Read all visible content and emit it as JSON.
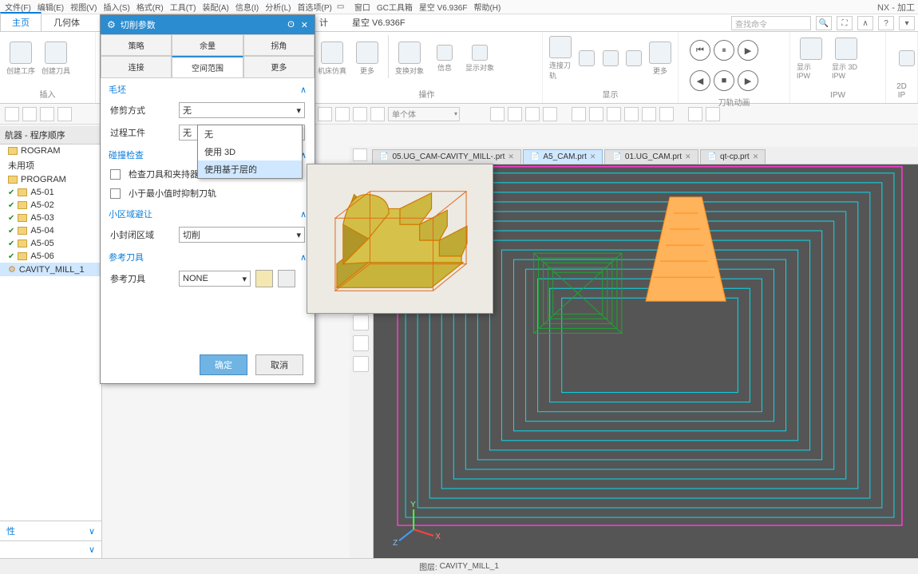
{
  "app_title": "NX - 加工",
  "menu": [
    "文件(F)",
    "编辑(E)",
    "视图(V)",
    "插入(S)",
    "格式(R)",
    "工具(T)",
    "装配(A)",
    "信息(I)",
    "分析(L)",
    "首选项(P)",
    "窗口",
    "GC工具箱",
    "星空 V6.936F",
    "帮助(H)"
  ],
  "ribbon_tabs": [
    "主页",
    "几何体",
    "计",
    "星空 V6.936F"
  ],
  "ribbon_tab_active": 0,
  "ribbon_groups": {
    "insert": "插入",
    "operate": "操作",
    "display": "显示",
    "toolpath": "刀轨动画",
    "ipw": "IPW",
    "2dipw": "2D IP"
  },
  "ribbon_btns": {
    "create_proc": "创建工序",
    "create_tool": "创建刀具",
    "machine": "机床仿真",
    "more1": "更多",
    "change_obj": "变换对象",
    "info": "信息",
    "show_obj": "显示对象",
    "connect_tool": "连接刀轨",
    "more2": "更多",
    "show_ipw": "显示 IPW",
    "show_3dipw": "显示 3D IPW"
  },
  "smallbar": {
    "select_label": "单个体"
  },
  "search_placeholder": "查找命令",
  "nav": {
    "header": "航器 - 程序顺序",
    "items": [
      {
        "text": "ROGRAM",
        "type": "folder"
      },
      {
        "text": "未用项",
        "type": "plain"
      },
      {
        "text": "PROGRAM",
        "type": "folder"
      },
      {
        "text": "A5-01",
        "type": "op",
        "chk": true
      },
      {
        "text": "A5-02",
        "type": "op",
        "chk": true
      },
      {
        "text": "A5-03",
        "type": "op",
        "chk": true
      },
      {
        "text": "A5-04",
        "type": "op",
        "chk": true
      },
      {
        "text": "A5-05",
        "type": "op",
        "chk": true
      },
      {
        "text": "A5-06",
        "type": "op",
        "chk": true
      },
      {
        "text": "CAVITY_MILL_1",
        "type": "tool",
        "sel": true
      }
    ],
    "bottom_section": "性"
  },
  "filetabs": [
    {
      "name": "05.UG_CAM-CAVITY_MILL-.prt",
      "active": false
    },
    {
      "name": "A5_CAM.prt",
      "active": true
    },
    {
      "name": "01.UG_CAM.prt",
      "active": false
    },
    {
      "name": "qt-cp.prt",
      "active": false
    }
  ],
  "status": {
    "label": "图层:",
    "value": "CAVITY_MILL_1"
  },
  "dialog": {
    "title": "切削参数",
    "tabs_top": [
      "策略",
      "余量",
      "拐角"
    ],
    "tabs_bot": [
      "连接",
      "空间范围",
      "更多"
    ],
    "active_tab": "空间范围",
    "sec_blank": "毛坯",
    "trim_mode": "修剪方式",
    "trim_mode_val": "无",
    "proc_wp": "过程工件",
    "proc_wp_val": "无",
    "proc_wp_opts": [
      "无",
      "使用 3D",
      "使用基于层的"
    ],
    "sec_collide": "碰撞检查",
    "chk1": "检查刀具和夹持器",
    "chk2": "小于最小值时抑制刀轨",
    "sec_small": "小区域避让",
    "small_area": "小封闭区域",
    "small_area_val": "切削",
    "sec_reftool": "参考刀具",
    "reftool_lbl": "参考刀具",
    "reftool_val": "NONE",
    "ok": "确定",
    "cancel": "取消"
  },
  "viewport_axes": {
    "x": "X",
    "y": "Y",
    "z": "Z"
  }
}
